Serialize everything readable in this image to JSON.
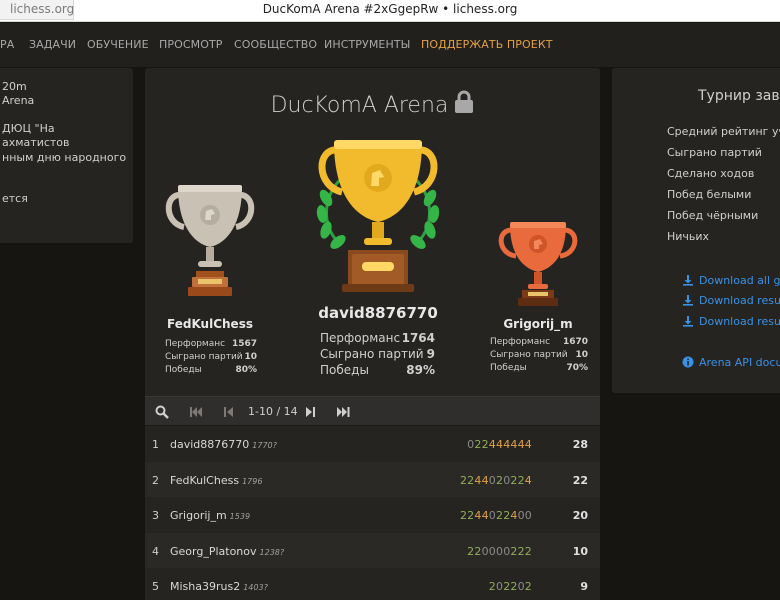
{
  "browser": {
    "tab_domain": "lichess.org",
    "window_title": "DucKomA Arena #2xGgepRw • lichess.org"
  },
  "nav": {
    "items": [
      "РА",
      "ЗАДАЧИ",
      "ОБУЧЕНИЕ",
      "ПРОСМОТР",
      "СООБЩЕСТВО",
      "ИНСТРУМЕНТЫ"
    ],
    "donate": "ПОДДЕРЖАТЬ ПРОЕКТ"
  },
  "left_panel": {
    "lines": [
      "20m",
      "Arena",
      "ДЮЦ \"На",
      "ахматистов",
      "нным дню народного",
      "ется"
    ]
  },
  "tournament": {
    "title": "DucKomA Arena",
    "icons": {
      "lock": "lock-icon"
    }
  },
  "podium": {
    "silver": {
      "name": "FedKulChess",
      "stats": [
        {
          "label": "Перформанс",
          "value": "1567"
        },
        {
          "label": "Сыграно партий",
          "value": "10"
        },
        {
          "label": "Победы",
          "value": "80%"
        }
      ]
    },
    "gold": {
      "name": "david8876770",
      "stats": [
        {
          "label": "Перформанс",
          "value": "1764"
        },
        {
          "label": "Сыграно партий",
          "value": "9"
        },
        {
          "label": "Победы",
          "value": "89%"
        }
      ]
    },
    "bronze": {
      "name": "Grigorij_m",
      "stats": [
        {
          "label": "Перформанс",
          "value": "1670"
        },
        {
          "label": "Сыграно партий",
          "value": "10"
        },
        {
          "label": "Победы",
          "value": "70%"
        }
      ]
    }
  },
  "pager": {
    "range": "1-10 / 14",
    "icons": [
      "search-icon",
      "first-page-icon",
      "prev-page-icon",
      "next-page-icon",
      "last-page-icon"
    ]
  },
  "standings": [
    {
      "rank": "1",
      "name": "david8876770",
      "rating": "1770?",
      "scores": "022444444",
      "total": "28"
    },
    {
      "rank": "2",
      "name": "FedKulChess",
      "rating": "1796",
      "scores": "2244020224",
      "total": "22"
    },
    {
      "rank": "3",
      "name": "Grigorij_m",
      "rating": "1539",
      "scores": "2244022400",
      "total": "20"
    },
    {
      "rank": "4",
      "name": "Georg_Platonov",
      "rating": "1238?",
      "scores": "220000222",
      "total": "10"
    },
    {
      "rank": "5",
      "name": "Misha39rus2",
      "rating": "1403?",
      "scores": "202202",
      "total": "9"
    }
  ],
  "right_panel": {
    "title": "Турнир зав",
    "stats_labels": [
      "Средний рейтинг учас",
      "Сыграно партий",
      "Сделано ходов",
      "Побед белыми",
      "Побед чёрными",
      "Ничьих"
    ],
    "links": [
      "Download all gam",
      "Download results",
      "Download results",
      "Arena API docum"
    ]
  },
  "colors": {
    "background": "#161512",
    "panel": "#262421",
    "accent_link": "#3692e7",
    "donate": "#e3a143",
    "score_win_streak": "#e3a143",
    "score_normal": "#8fae5a",
    "score_zero": "#8a8a8a",
    "gold": "#f2bb2d",
    "silver": "#c9c1b4",
    "bronze": "#e86a3d"
  }
}
